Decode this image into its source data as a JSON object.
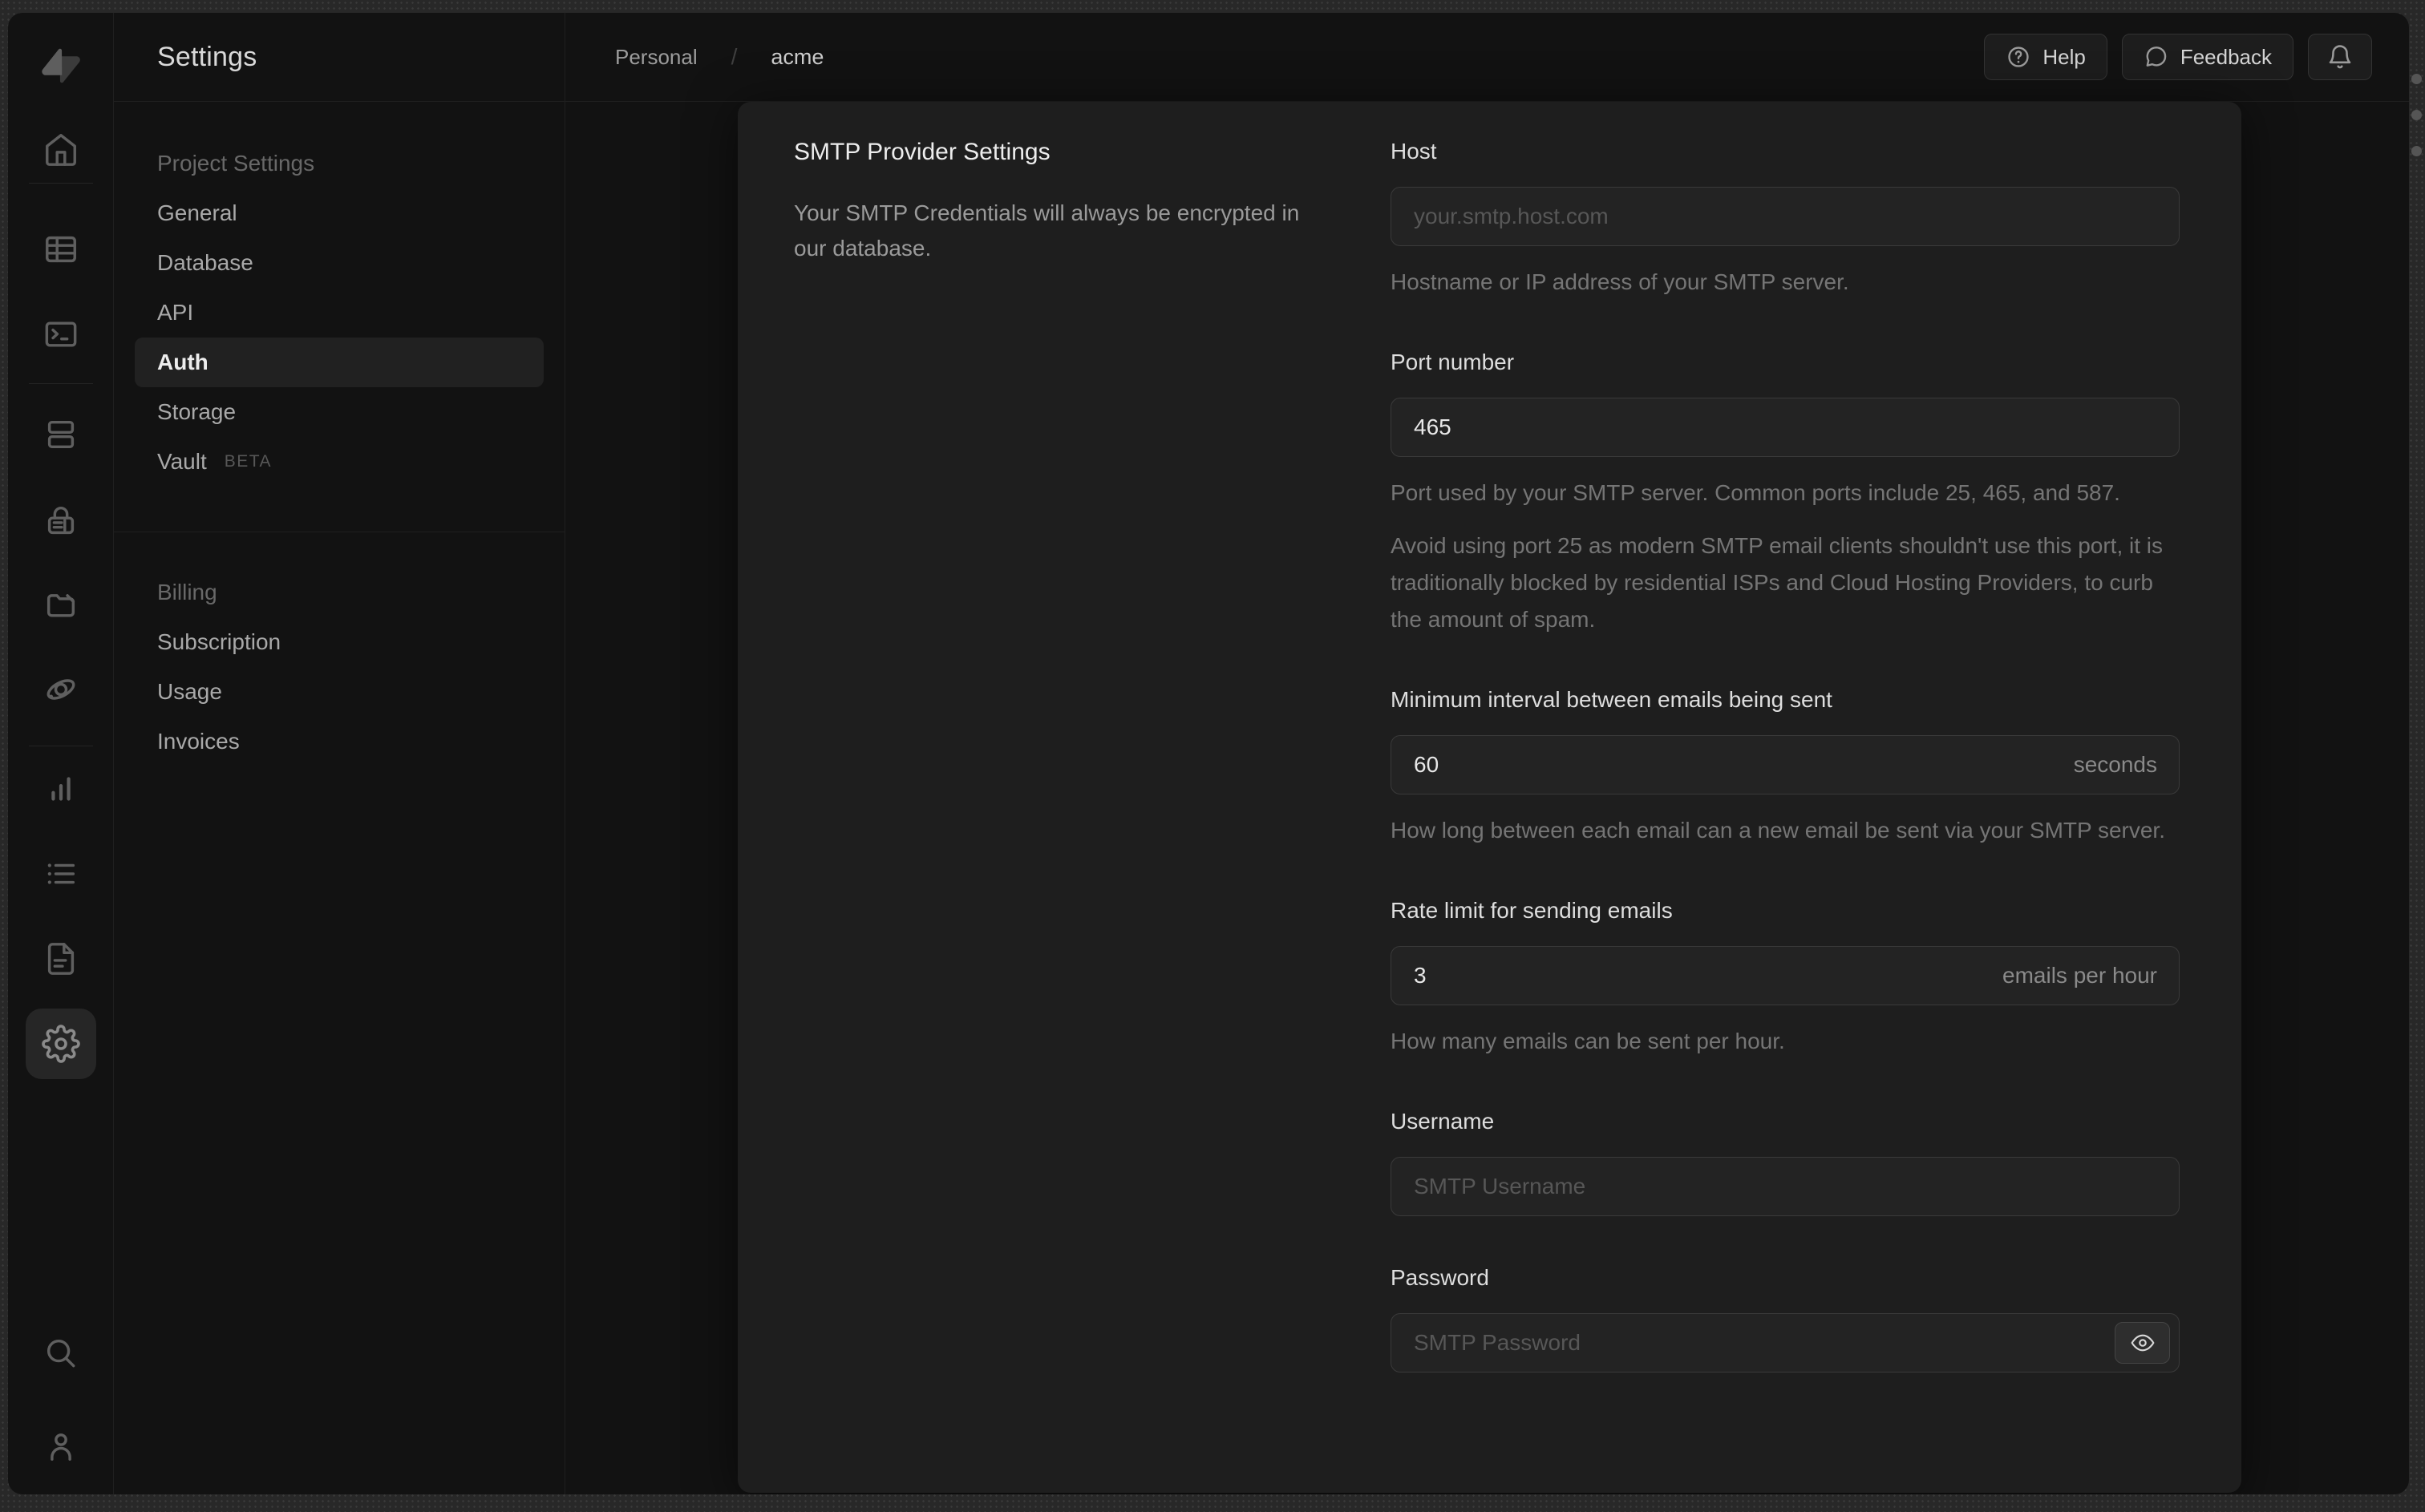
{
  "nav": {
    "title": "Settings",
    "sections": [
      {
        "header": "Project Settings",
        "items": [
          "General",
          "Database",
          "API",
          "Auth",
          "Storage",
          "Vault"
        ]
      },
      {
        "header": "Billing",
        "items": [
          "Subscription",
          "Usage",
          "Invoices"
        ]
      }
    ],
    "active_item": "Auth",
    "vault_badge": "BETA"
  },
  "icons": [
    "supabase-logo",
    "home-icon",
    "table-editor-icon",
    "sql-editor-icon",
    "database-icon",
    "auth-lock-icon",
    "storage-folder-icon",
    "edge-functions-icon",
    "reports-icon",
    "logs-icon",
    "docs-icon",
    "settings-gear-icon",
    "search-icon",
    "user-icon",
    "help-icon",
    "feedback-icon",
    "bell-icon",
    "eye-icon"
  ],
  "breadcrumb": {
    "org": "Personal",
    "separator": "/",
    "project": "acme"
  },
  "topbar": {
    "help_label": "Help",
    "feedback_label": "Feedback"
  },
  "panel": {
    "title": "SMTP Provider Settings",
    "description": "Your SMTP Credentials will always be encrypted in our database.",
    "fields": {
      "host": {
        "label": "Host",
        "placeholder": "your.smtp.host.com",
        "helper": "Hostname or IP address of your SMTP server."
      },
      "port": {
        "label": "Port number",
        "value": "465",
        "helper1": "Port used by your SMTP server. Common ports include 25, 465, and 587.",
        "helper2": "Avoid using port 25 as modern SMTP email clients shouldn't use this port, it is traditionally blocked by residential ISPs and Cloud Hosting Providers, to curb the amount of spam."
      },
      "interval": {
        "label": "Minimum interval between emails being sent",
        "value": "60",
        "suffix": "seconds",
        "helper": "How long between each email can a new email be sent via your SMTP server."
      },
      "rate": {
        "label": "Rate limit for sending emails",
        "value": "3",
        "suffix": "emails per hour",
        "helper": "How many emails can be sent per hour."
      },
      "username": {
        "label": "Username",
        "placeholder": "SMTP Username"
      },
      "password": {
        "label": "Password",
        "placeholder": "SMTP Password"
      }
    }
  },
  "colors": {
    "window_bg": "#121212",
    "panel_bg": "#1e1e1e",
    "frame_bg": "#282828",
    "accent_text": "#ededed",
    "muted_text": "#757575",
    "border": "#3a3a3a"
  }
}
